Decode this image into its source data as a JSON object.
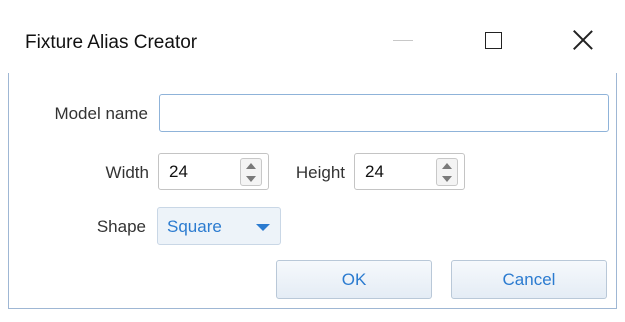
{
  "window": {
    "title": "Fixture Alias Creator",
    "controls": {
      "minimize": "minimize-icon",
      "maximize": "maximize-icon",
      "close": "close-icon"
    }
  },
  "form": {
    "model_name": {
      "label": "Model name",
      "value": "",
      "placeholder": ""
    },
    "width": {
      "label": "Width",
      "value": "24"
    },
    "height": {
      "label": "Height",
      "value": "24"
    },
    "shape": {
      "label": "Shape",
      "selected": "Square"
    }
  },
  "buttons": {
    "ok": "OK",
    "cancel": "Cancel"
  },
  "colors": {
    "accent": "#2b7bd0",
    "border": "#8fb3d9",
    "window_border": "#9fb7d4"
  }
}
